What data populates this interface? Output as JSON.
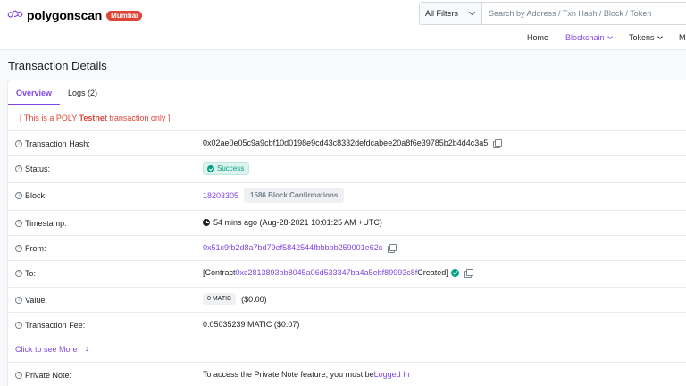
{
  "header": {
    "logo_text": "polygonscan",
    "network_badge": "Mumbai",
    "search": {
      "filter_label": "All Filters",
      "placeholder": "Search by Address / Txn Hash / Block / Token"
    },
    "nav": {
      "home": "Home",
      "blockchain": "Blockchain",
      "tokens": "Tokens",
      "more": "M"
    }
  },
  "page_title": "Transaction Details",
  "tabs": {
    "overview": "Overview",
    "logs": "Logs (2)"
  },
  "testnet_note": {
    "prefix": "[ This is a POLY ",
    "bold": "Testnet",
    "suffix": " transaction only ]"
  },
  "details": {
    "tx_hash": {
      "label": "Transaction Hash:",
      "value": "0x02ae0e05c9a9cbf10d0198e9cd43c8332defdcabee20a8f6e39785b2b4d4c3a5"
    },
    "status": {
      "label": "Status:",
      "value": "Success"
    },
    "block": {
      "label": "Block:",
      "value": "18203305",
      "confirmations": "1586 Block Confirmations"
    },
    "timestamp": {
      "label": "Timestamp:",
      "value": "54 mins ago (Aug-28-2021 10:01:25 AM +UTC)"
    },
    "from": {
      "label": "From:",
      "value": "0x51c9fb2d8a7bd79ef5842544fbbbbb259001e62c"
    },
    "to": {
      "label": "To:",
      "prefix": "[Contract ",
      "contract": "0xc2813893bb8045a06d533347ba4a5ebf89993c8f",
      "suffix": " Created]"
    },
    "value": {
      "label": "Value:",
      "amount": "0 MATIC",
      "usd": "($0.00)"
    },
    "fee": {
      "label": "Transaction Fee:",
      "value": "0.05035239 MATIC ($0.07)"
    },
    "see_more": "Click to see More",
    "private_note": {
      "label": "Private Note:",
      "text": "To access the Private Note feature, you must be ",
      "link": "Logged In"
    }
  },
  "colors": {
    "accent": "#8247e5",
    "danger": "#de4437",
    "success": "#00a186"
  }
}
